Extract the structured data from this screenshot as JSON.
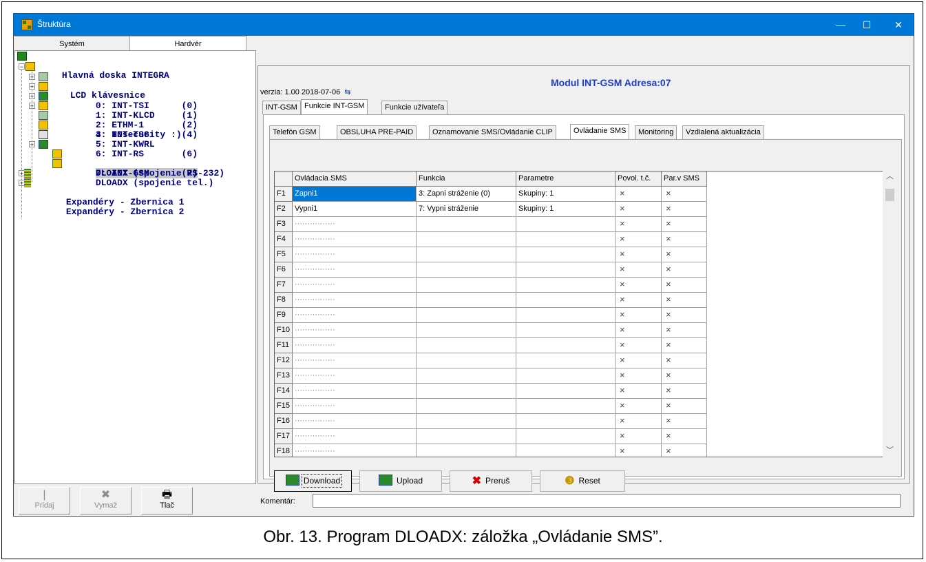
{
  "window": {
    "title": "Štruktúra",
    "controls": {
      "minimize": "—",
      "maximize": "☐",
      "close": "✕"
    }
  },
  "left_tabs": [
    "Systém",
    "Hardvér"
  ],
  "tree": [
    {
      "text": "Hlavná doska INTEGRA",
      "icon": "mainboard-icon"
    },
    {
      "text": "LCD klávesnice",
      "icon": "keypad-icon"
    },
    {
      "text": "0: INT-TSI      (0)",
      "icon": "touchscreen-icon"
    },
    {
      "text": "1: INT-KLCD     (1)",
      "icon": "keypad-icon"
    },
    {
      "text": "2: ETHM-1       (2)",
      "icon": "network-module-icon"
    },
    {
      "text": "3: HDsecurity :)",
      "icon": "keypad-icon"
    },
    {
      "text": "4: INT-TSG      (4)",
      "icon": "touchscreen-icon"
    },
    {
      "text": "5: INT-KWRL",
      "icon": "keypad-icon"
    },
    {
      "text": "6: INT-RS       (6)",
      "icon": "converter-icon"
    },
    {
      "text": "7: INT-GSM      (7)",
      "icon": "network-module-icon"
    },
    {
      "text": "DLOADX (spojenie RS-232)",
      "icon": "dloadx-icon"
    },
    {
      "text": "DLOADX (spojenie tel.)",
      "icon": "dloadx-icon"
    },
    {
      "text": "Expandéry - Zbernica 1",
      "icon": "expander-icon"
    },
    {
      "text": "Expandéry - Zbernica 2",
      "icon": "expander-icon"
    }
  ],
  "left_toolbar": {
    "add": "Pridaj",
    "delete": "Vymaž",
    "print": "Tlač"
  },
  "module_title": "Modul INT-GSM Adresa:07",
  "version": "verzia: 1.00 2018-07-06",
  "tabs": [
    "INT-GSM",
    "Funkcie INT-GSM",
    "Funkcie užívateľa"
  ],
  "subtabs": [
    "Telefón GSM",
    "OBSLUHA PRE-PAID",
    "Oznamovanie SMS/Ovládanie CLIP",
    "Ovládanie SMS",
    "Monitoring",
    "Vzdialená aktualizácia"
  ],
  "grid": {
    "headers": [
      "",
      "Ovládacia SMS",
      "Funkcia",
      "Parametre",
      "Povol. t.č.",
      "Par.v SMS"
    ],
    "rows": [
      [
        "F1",
        "Zapni1",
        "3: Zapni stráženie (0)",
        "Skupiny: 1",
        "×",
        "×"
      ],
      [
        "F2",
        "Vypni1",
        "7: Vypni stráženie",
        "Skupiny: 1",
        "×",
        "×"
      ],
      [
        "F3",
        "················",
        "",
        "",
        "×",
        "×"
      ],
      [
        "F4",
        "················",
        "",
        "",
        "×",
        "×"
      ],
      [
        "F5",
        "················",
        "",
        "",
        "×",
        "×"
      ],
      [
        "F6",
        "················",
        "",
        "",
        "×",
        "×"
      ],
      [
        "F7",
        "················",
        "",
        "",
        "×",
        "×"
      ],
      [
        "F8",
        "················",
        "",
        "",
        "×",
        "×"
      ],
      [
        "F9",
        "················",
        "",
        "",
        "×",
        "×"
      ],
      [
        "F10",
        "················",
        "",
        "",
        "×",
        "×"
      ],
      [
        "F11",
        "················",
        "",
        "",
        "×",
        "×"
      ],
      [
        "F12",
        "················",
        "",
        "",
        "×",
        "×"
      ],
      [
        "F13",
        "················",
        "",
        "",
        "×",
        "×"
      ],
      [
        "F14",
        "················",
        "",
        "",
        "×",
        "×"
      ],
      [
        "F15",
        "················",
        "",
        "",
        "×",
        "×"
      ],
      [
        "F16",
        "················",
        "",
        "",
        "×",
        "×"
      ],
      [
        "F17",
        "················",
        "",
        "",
        "×",
        "×"
      ],
      [
        "F18",
        "················",
        "",
        "",
        "×",
        "×"
      ]
    ]
  },
  "buttons": {
    "download": "Download",
    "upload": "Upload",
    "abort": "Preruš",
    "reset": "Reset"
  },
  "comment": {
    "label": "Komentár:",
    "value": ""
  },
  "caption": "Obr. 13. Program DLOADX: záložka „Ovládanie SMS”."
}
